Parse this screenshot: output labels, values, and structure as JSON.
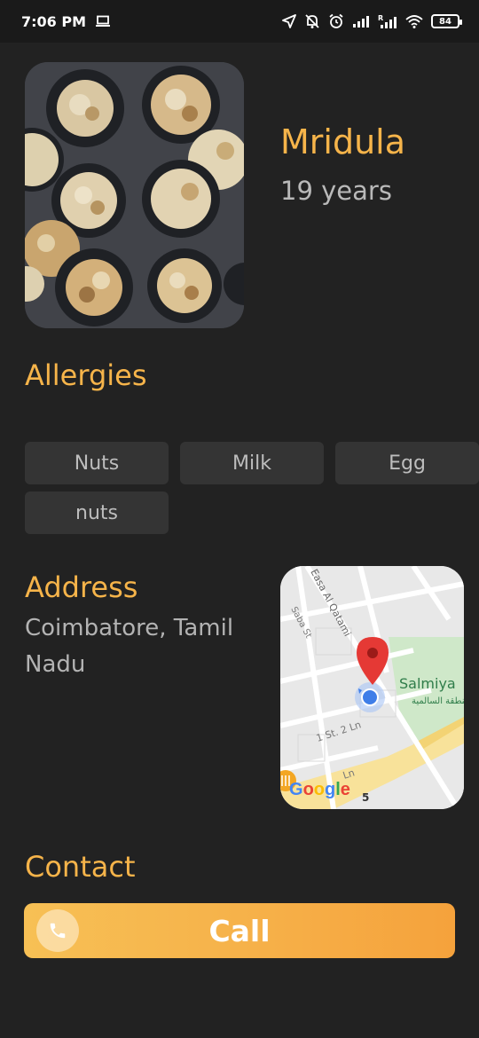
{
  "status_bar": {
    "time": "7:06 PM",
    "battery": "84",
    "icons": [
      "laptop-icon",
      "location-arrow-icon",
      "bell-off-icon",
      "alarm-icon",
      "signal-icon",
      "signal-r-icon",
      "wifi-icon",
      "battery-icon"
    ]
  },
  "profile": {
    "name": "Mridula",
    "age": "19 years",
    "photo": "food-photo"
  },
  "allergies": {
    "title": "Allergies",
    "items": [
      "Nuts",
      "Milk",
      "Egg",
      "nuts"
    ]
  },
  "address": {
    "title": "Address",
    "text": "Coimbatore, Tamil Nadu",
    "map": {
      "streets": [
        "Easa Al Qatami",
        "Saba St",
        "1 St. 2 Ln",
        "Ln"
      ],
      "area_label": "Salmiya",
      "area_label_arabic": "منطقة السالمية",
      "road_number": "5",
      "brand": "Google"
    }
  },
  "contact": {
    "title": "Contact",
    "call_label": "Call"
  },
  "colors": {
    "accent": "#f6b44a",
    "background": "#222222",
    "chip": "#343434"
  }
}
